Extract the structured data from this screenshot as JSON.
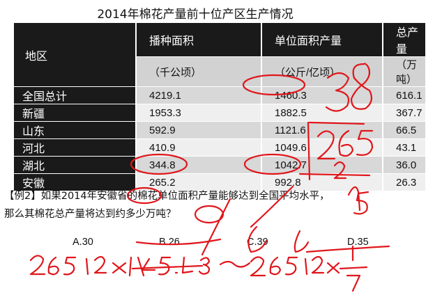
{
  "title": "2014年棉花产量前十位产区生产情况",
  "table": {
    "headers": {
      "region": "地区",
      "area": "播种面积",
      "yield": "单位面积产量",
      "total": "总产量"
    },
    "units": {
      "area": "（千公顷）",
      "yield": "（公斤/亿顷）",
      "total": "（万吨）"
    },
    "rows": [
      {
        "region": "全国总计",
        "area": "4219.1",
        "yield": "1460.3",
        "total": "616.1"
      },
      {
        "region": "新疆",
        "area": "1953.3",
        "yield": "1882.5",
        "total": "367.7"
      },
      {
        "region": "山东",
        "area": "592.9",
        "yield": "1121.6",
        "total": "66.5"
      },
      {
        "region": "河北",
        "area": "410.9",
        "yield": "1049.6",
        "total": "43.1"
      },
      {
        "region": "湖北",
        "area": "344.8",
        "yield": "1042.7",
        "total": "36.0"
      },
      {
        "region": "安徽",
        "area": "265.2",
        "yield": "992.8",
        "total": "26.3"
      }
    ]
  },
  "question": {
    "line1": "【例2】如果2014年安徽省的棉花单位面积产量能够达到全国平均水平，",
    "line2": "那么其棉花总产量将达到约多少万吨？"
  },
  "choices": [
    "A.30",
    "B.26",
    "C.39",
    "D.35"
  ],
  "annotations": {
    "ink_color": "#e0161b",
    "handwriting_text": [
      "38",
      "265",
      "2",
      "15",
      "265.2×1460.3 ≈ 265.2×",
      "1",
      "7"
    ]
  }
}
